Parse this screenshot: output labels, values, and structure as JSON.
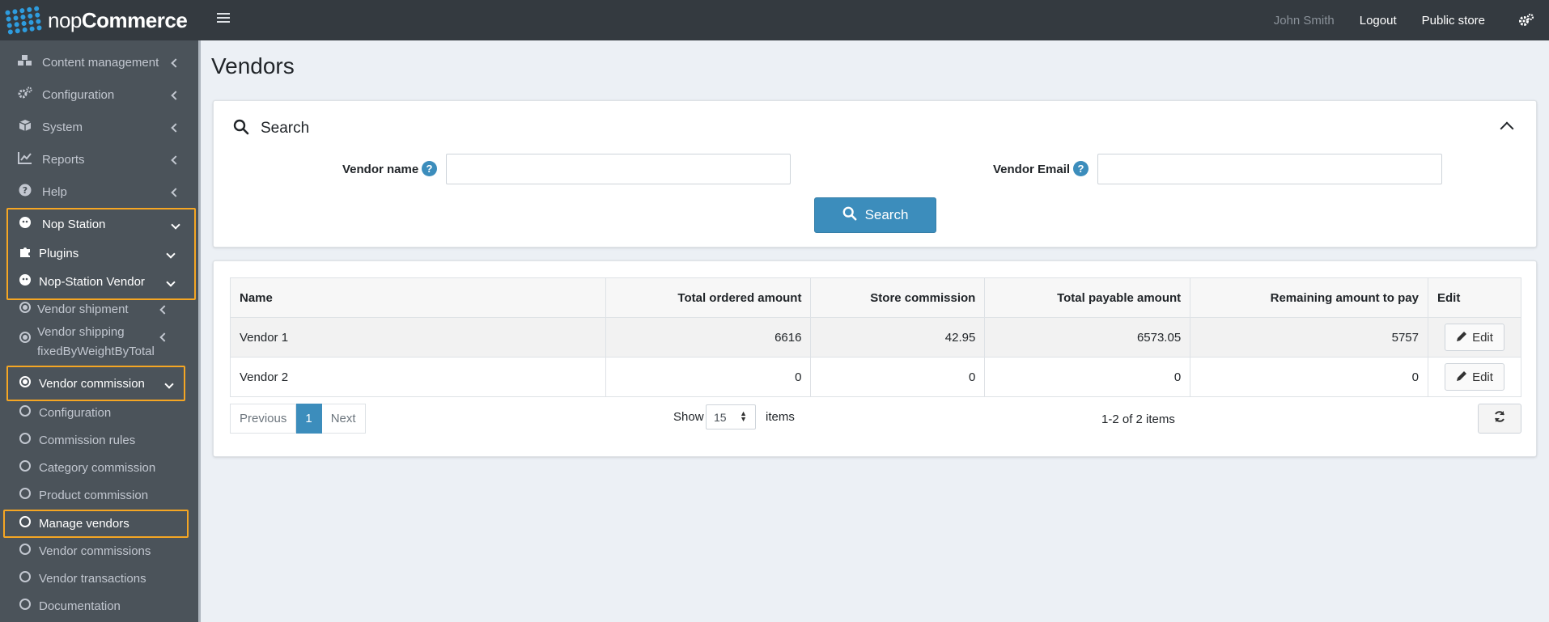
{
  "brand": {
    "name_light": "nop",
    "name_bold": "Commerce"
  },
  "header": {
    "user": "John Smith",
    "logout": "Logout",
    "public_store": "Public store"
  },
  "sidebar": {
    "items": [
      {
        "label": "Content management",
        "icon": "cubes-icon"
      },
      {
        "label": "Configuration",
        "icon": "gears-icon"
      },
      {
        "label": "System",
        "icon": "cube-icon"
      },
      {
        "label": "Reports",
        "icon": "line-chart-icon"
      },
      {
        "label": "Help",
        "icon": "question-circle-icon"
      },
      {
        "label": "Nop Station",
        "icon": "nopstation-icon"
      },
      {
        "label": "Plugins",
        "icon": "puzzle-icon"
      },
      {
        "label": "Nop-Station Vendor",
        "icon": "nopstation-icon"
      },
      {
        "label": "Vendor shipment",
        "icon": "dot-circle-icon"
      },
      {
        "label": "Vendor shipping",
        "label2": "fixedByWeightByTotal",
        "icon": "dot-circle-icon"
      },
      {
        "label": "Vendor commission",
        "icon": "dot-circle-icon"
      },
      {
        "label": "Configuration",
        "icon": "circle-icon"
      },
      {
        "label": "Commission rules",
        "icon": "circle-icon"
      },
      {
        "label": "Category commission",
        "icon": "circle-icon"
      },
      {
        "label": "Product commission",
        "icon": "circle-icon"
      },
      {
        "label": "Manage vendors",
        "icon": "circle-icon"
      },
      {
        "label": "Vendor commissions",
        "icon": "circle-icon"
      },
      {
        "label": "Vendor transactions",
        "icon": "circle-icon"
      },
      {
        "label": "Documentation",
        "icon": "circle-icon"
      }
    ]
  },
  "page": {
    "title": "Vendors"
  },
  "search": {
    "title": "Search",
    "vendor_name_label": "Vendor name",
    "vendor_name_value": "",
    "vendor_email_label": "Vendor Email",
    "vendor_email_value": "",
    "button": "Search"
  },
  "grid": {
    "columns": [
      "Name",
      "Total ordered amount",
      "Store commission",
      "Total payable amount",
      "Remaining amount to pay",
      "Edit"
    ],
    "rows": [
      {
        "name": "Vendor 1",
        "total_ordered": "6616",
        "store_commission": "42.95",
        "total_payable": "6573.05",
        "remaining": "5757",
        "edit": "Edit"
      },
      {
        "name": "Vendor 2",
        "total_ordered": "0",
        "store_commission": "0",
        "total_payable": "0",
        "remaining": "0",
        "edit": "Edit"
      }
    ],
    "pager": {
      "previous": "Previous",
      "current": "1",
      "next": "Next"
    },
    "show_label": "Show",
    "page_size": "15",
    "items_label": "items",
    "items_info": "1-2 of 2 items"
  }
}
